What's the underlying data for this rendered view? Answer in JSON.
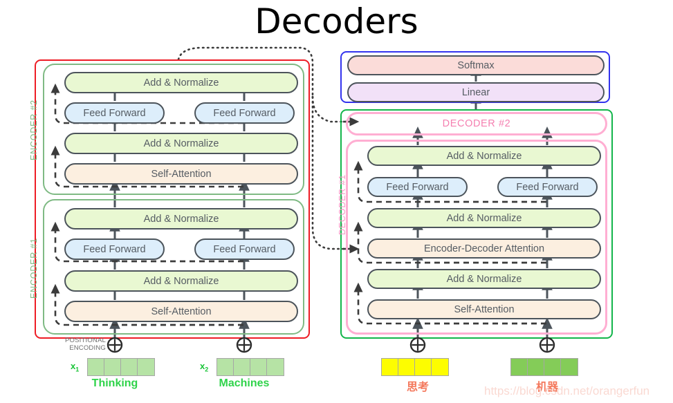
{
  "title": "Decoders",
  "encoder_stack": {
    "outline_color": "#ee1c25",
    "labels": [
      {
        "text": "ENCODER #2"
      },
      {
        "text": "ENCODER #1"
      }
    ],
    "encoder2": {
      "add_norm_top": "Add & Normalize",
      "feed_forward_left": "Feed Forward",
      "feed_forward_right": "Feed Forward",
      "add_norm_bottom": "Add & Normalize",
      "self_attention": "Self-Attention"
    },
    "encoder1": {
      "add_norm_top": "Add & Normalize",
      "feed_forward_left": "Feed Forward",
      "feed_forward_right": "Feed Forward",
      "add_norm_bottom": "Add & Normalize",
      "self_attention": "Self-Attention"
    }
  },
  "output_head": {
    "outline_color": "#3333ee",
    "softmax": "Softmax",
    "linear": "Linear"
  },
  "decoder_stack": {
    "outline_color": "#12b54a",
    "label": "DECODER #1",
    "decoder2_label": "DECODER #2",
    "decoder1": {
      "add_norm_top": "Add & Normalize",
      "feed_forward_left": "Feed Forward",
      "feed_forward_right": "Feed Forward",
      "add_norm_mid": "Add & Normalize",
      "encoder_decoder_attention": "Encoder-Decoder Attention",
      "add_norm_bottom": "Add & Normalize",
      "self_attention": "Self-Attention"
    }
  },
  "inputs": {
    "positional_encoding_line1": "POSITIONAL",
    "positional_encoding_line2": "ENCODING",
    "plus_symbol": "⊕",
    "tokens": [
      {
        "x_label": "x",
        "x_sub": "1",
        "word": "Thinking",
        "cells": 4,
        "cell_class": "cell-green-lite"
      },
      {
        "x_label": "x",
        "x_sub": "2",
        "word": "Machines",
        "cells": 4,
        "cell_class": "cell-green-lite"
      }
    ]
  },
  "outputs": {
    "plus_symbol": "⊕",
    "tokens": [
      {
        "word": "思考",
        "cells": 4,
        "cell_class": "cell-yellow"
      },
      {
        "word": "机器",
        "cells": 4,
        "cell_class": "cell-green"
      }
    ]
  },
  "watermark": "https://blog.csdn.net/orangerfun"
}
